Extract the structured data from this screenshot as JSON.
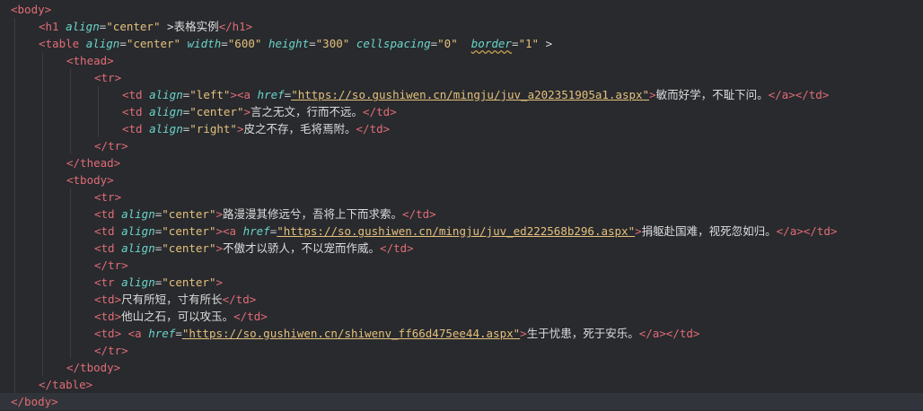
{
  "code": {
    "lines": [
      {
        "indent": 0,
        "tokens": [
          [
            "t",
            "<body>"
          ]
        ]
      },
      {
        "indent": 1,
        "tokens": [
          [
            "t",
            "<h1 "
          ],
          [
            "a",
            "align"
          ],
          [
            "p",
            "="
          ],
          [
            "v",
            "\"center\""
          ],
          [
            "x",
            " >"
          ],
          [
            "x",
            "表格实例"
          ],
          [
            "t",
            "</h1>"
          ]
        ]
      },
      {
        "indent": 1,
        "tokens": [
          [
            "t",
            "<table "
          ],
          [
            "a",
            "align"
          ],
          [
            "p",
            "="
          ],
          [
            "v",
            "\"center\""
          ],
          [
            "x",
            " "
          ],
          [
            "a",
            "width"
          ],
          [
            "p",
            "="
          ],
          [
            "v",
            "\"600\""
          ],
          [
            "x",
            " "
          ],
          [
            "a",
            "height"
          ],
          [
            "p",
            "="
          ],
          [
            "v",
            "\"300\""
          ],
          [
            "x",
            " "
          ],
          [
            "a",
            "cellspacing"
          ],
          [
            "p",
            "="
          ],
          [
            "v",
            "\"0\""
          ],
          [
            "x",
            "  "
          ],
          [
            "a",
            "border",
            "err"
          ],
          [
            "p",
            "="
          ],
          [
            "v",
            "\"1\""
          ],
          [
            "x",
            " >"
          ]
        ]
      },
      {
        "indent": 2,
        "tokens": [
          [
            "t",
            "<thead>"
          ]
        ]
      },
      {
        "indent": 3,
        "tokens": [
          [
            "t",
            "<tr>"
          ]
        ]
      },
      {
        "indent": 4,
        "tokens": [
          [
            "t",
            "<td "
          ],
          [
            "a",
            "align"
          ],
          [
            "p",
            "="
          ],
          [
            "v",
            "\"left\""
          ],
          [
            "t",
            ">"
          ],
          [
            "t",
            "<a "
          ],
          [
            "a",
            "href"
          ],
          [
            "p",
            "="
          ],
          [
            "u",
            "\"https://so.gushiwen.cn/mingju/juv_a202351905a1.aspx\""
          ],
          [
            "t",
            ">"
          ],
          [
            "x",
            "敏而好学，不耻下问。"
          ],
          [
            "t",
            "</a></td>"
          ]
        ]
      },
      {
        "indent": 4,
        "tokens": [
          [
            "t",
            "<td "
          ],
          [
            "a",
            "align"
          ],
          [
            "p",
            "="
          ],
          [
            "v",
            "\"center\""
          ],
          [
            "t",
            ">"
          ],
          [
            "x",
            "言之无文，行而不远。"
          ],
          [
            "t",
            "</td>"
          ]
        ]
      },
      {
        "indent": 4,
        "tokens": [
          [
            "t",
            "<td "
          ],
          [
            "a",
            "align"
          ],
          [
            "p",
            "="
          ],
          [
            "v",
            "\"right\""
          ],
          [
            "t",
            ">"
          ],
          [
            "x",
            "皮之不存，毛将焉附。"
          ],
          [
            "t",
            "</td>"
          ]
        ]
      },
      {
        "indent": 3,
        "tokens": [
          [
            "t",
            "</tr>"
          ]
        ]
      },
      {
        "indent": 2,
        "tokens": [
          [
            "t",
            "</thead>"
          ]
        ]
      },
      {
        "indent": 2,
        "tokens": [
          [
            "t",
            "<tbody>"
          ]
        ]
      },
      {
        "indent": 3,
        "tokens": [
          [
            "t",
            "<tr>"
          ]
        ]
      },
      {
        "indent": 3,
        "tokens": [
          [
            "t",
            "<td "
          ],
          [
            "a",
            "align"
          ],
          [
            "p",
            "="
          ],
          [
            "v",
            "\"center\""
          ],
          [
            "t",
            ">"
          ],
          [
            "x",
            "路漫漫其修远兮，吾将上下而求索。"
          ],
          [
            "t",
            "</td>"
          ]
        ]
      },
      {
        "indent": 3,
        "tokens": [
          [
            "t",
            "<td "
          ],
          [
            "a",
            "align"
          ],
          [
            "p",
            "="
          ],
          [
            "v",
            "\"center\""
          ],
          [
            "t",
            ">"
          ],
          [
            "t",
            "<a "
          ],
          [
            "a",
            "href"
          ],
          [
            "p",
            "="
          ],
          [
            "u",
            "\"https://so.gushiwen.cn/mingju/juv_ed222568b296.aspx\""
          ],
          [
            "t",
            ">"
          ],
          [
            "x",
            "捐躯赴国难，视死忽如归。"
          ],
          [
            "t",
            "</a></td>"
          ]
        ]
      },
      {
        "indent": 3,
        "tokens": [
          [
            "t",
            "<td "
          ],
          [
            "a",
            "align"
          ],
          [
            "p",
            "="
          ],
          [
            "v",
            "\"center\""
          ],
          [
            "t",
            ">"
          ],
          [
            "x",
            "不傲才以骄人，不以宠而作威。"
          ],
          [
            "t",
            "</td>"
          ]
        ]
      },
      {
        "indent": 3,
        "tokens": [
          [
            "t",
            "</tr>"
          ]
        ]
      },
      {
        "indent": 3,
        "tokens": [
          [
            "t",
            "<tr "
          ],
          [
            "a",
            "align"
          ],
          [
            "p",
            "="
          ],
          [
            "v",
            "\"center\""
          ],
          [
            "t",
            ">"
          ]
        ]
      },
      {
        "indent": 3,
        "tokens": [
          [
            "t",
            "<td>"
          ],
          [
            "x",
            "尺有所短，寸有所长"
          ],
          [
            "t",
            "</td>"
          ]
        ]
      },
      {
        "indent": 3,
        "tokens": [
          [
            "t",
            "<td>"
          ],
          [
            "x",
            "他山之石，可以攻玉。"
          ],
          [
            "t",
            "</td>"
          ]
        ]
      },
      {
        "indent": 3,
        "tokens": [
          [
            "t",
            "<td>"
          ],
          [
            "x",
            " "
          ],
          [
            "t",
            "<a "
          ],
          [
            "a",
            "href"
          ],
          [
            "p",
            "="
          ],
          [
            "u",
            "\"https://so.gushiwen.cn/shiwenv_ff66d475ee44.aspx\""
          ],
          [
            "t",
            ">"
          ],
          [
            "x",
            "生于忧患，死于安乐。"
          ],
          [
            "t",
            "</a></td>"
          ]
        ]
      },
      {
        "indent": 3,
        "tokens": [
          [
            "t",
            "</tr>"
          ]
        ]
      },
      {
        "indent": 2,
        "tokens": [
          [
            "t",
            "</tbody>"
          ]
        ]
      },
      {
        "indent": 1,
        "tokens": [
          [
            "t",
            "</table>"
          ]
        ]
      },
      {
        "indent": 0,
        "tokens": [
          [
            "t",
            "</body>"
          ]
        ],
        "active": true
      }
    ]
  }
}
